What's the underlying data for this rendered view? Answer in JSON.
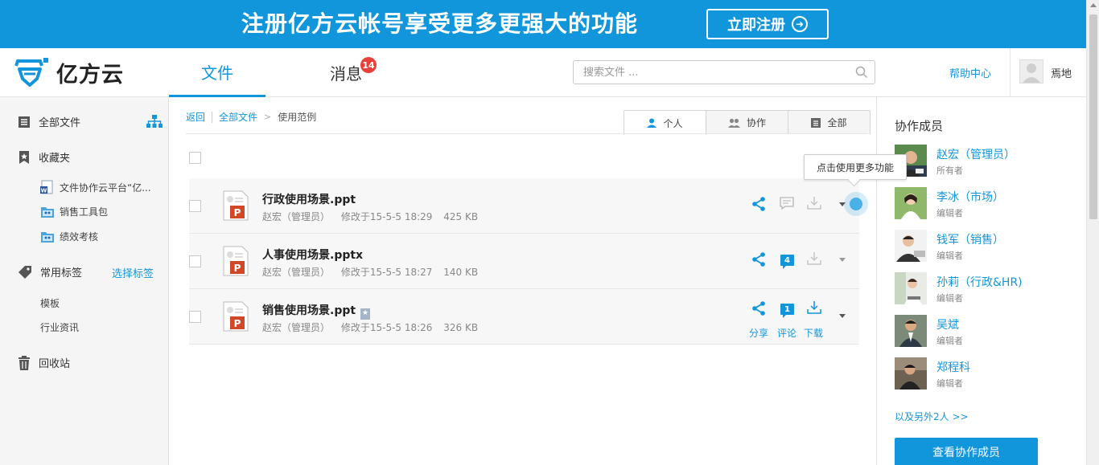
{
  "banner": {
    "text": "注册亿方云帐号享受更多更强大的功能",
    "button_label": "立即注册",
    "color": "#1296db"
  },
  "header": {
    "logo_text": "亿方云",
    "tabs": [
      {
        "label": "文件",
        "active": true
      },
      {
        "label": "消息",
        "active": false,
        "badge": "14"
      }
    ],
    "search_placeholder": "搜索文件 ...",
    "help_label": "帮助中心",
    "user_name": "焉地"
  },
  "sidebar": {
    "all_files": "全部文件",
    "favorites": "收藏夹",
    "fav_items": [
      {
        "label": "文件协作云平台“亿...",
        "icon": "word-doc-icon"
      },
      {
        "label": "销售工具包",
        "icon": "shared-folder-icon"
      },
      {
        "label": "绩效考核",
        "icon": "shared-folder-icon"
      }
    ],
    "tags_title": "常用标签",
    "select_tags": "选择标签",
    "tags": [
      "模板",
      "行业资讯"
    ],
    "recycle": "回收站"
  },
  "main": {
    "breadcrumb": {
      "back": "返回",
      "all_files": "全部文件",
      "current": "使用范例"
    },
    "view_tabs": [
      {
        "label": "个人",
        "icon": "person-icon",
        "active": true
      },
      {
        "label": "协作",
        "icon": "group-icon",
        "active": false
      },
      {
        "label": "全部",
        "icon": "list-icon",
        "active": false
      }
    ],
    "files": [
      {
        "name": "行政使用场景.ppt",
        "owner": "赵宏（管理员）",
        "modified": "修改于15-5-5 18:29",
        "size": "425 KB",
        "comments": "",
        "starred": false
      },
      {
        "name": "人事使用场景.pptx",
        "owner": "赵宏（管理员）",
        "modified": "修改于15-5-5 18:27",
        "size": "140 KB",
        "comments": "4",
        "starred": false
      },
      {
        "name": "销售使用场景.ppt",
        "owner": "赵宏（管理员）",
        "modified": "修改于15-5-5 18:26",
        "size": "326 KB",
        "comments": "1",
        "starred": true
      }
    ],
    "action_labels": {
      "share": "分享",
      "comment": "评论",
      "download": "下载"
    },
    "tooltip": "点击使用更多功能"
  },
  "right_panel": {
    "title": "协作成员",
    "members": [
      {
        "name": "赵宏（管理员）",
        "role": "所有者"
      },
      {
        "name": "李冰（市场）",
        "role": "编辑者"
      },
      {
        "name": "钱军（销售）",
        "role": "编辑者"
      },
      {
        "name": "孙莉（行政&HR)",
        "role": "编辑者"
      },
      {
        "name": "吴斌",
        "role": "编辑者"
      },
      {
        "name": "郑程科",
        "role": "编辑者"
      }
    ],
    "more": "以及另外2人 >>",
    "view_button": "查看协作成员"
  }
}
